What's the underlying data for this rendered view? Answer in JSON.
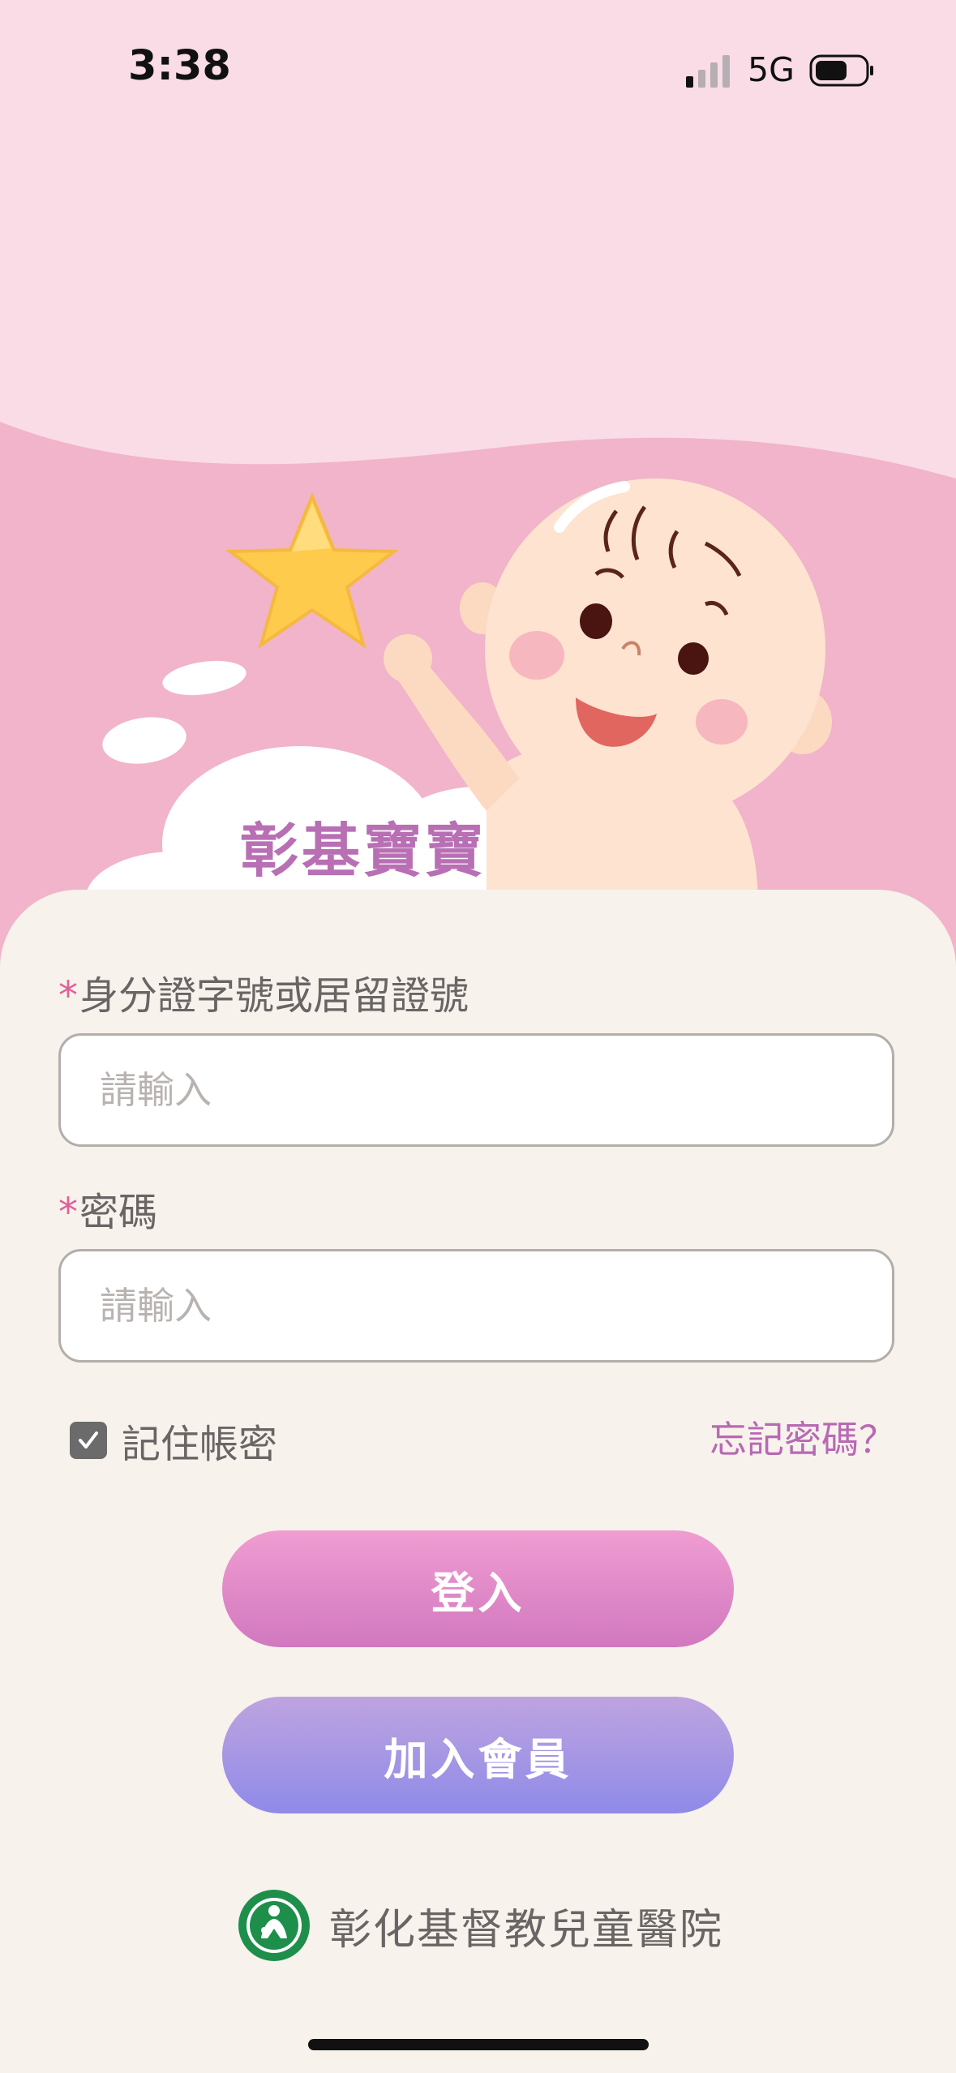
{
  "status_bar": {
    "time": "3:38",
    "network": "5G"
  },
  "app": {
    "title": "彰基寶寶"
  },
  "form": {
    "id_label": "身分證字號或居留證號",
    "id_placeholder": "請輸入",
    "password_label": "密碼",
    "password_placeholder": "請輸入",
    "required_mark": "*",
    "remember_label": "記住帳密",
    "remember_checked": true,
    "forgot_label": "忘記密碼？"
  },
  "buttons": {
    "login": "登入",
    "join": "加入會員"
  },
  "footer": {
    "hospital_name": "彰化基督教兒童醫院"
  },
  "colors": {
    "accent_pink": "#d178bf",
    "accent_purple": "#8f8ae8",
    "link": "#b869b4",
    "required": "#e0609a"
  }
}
